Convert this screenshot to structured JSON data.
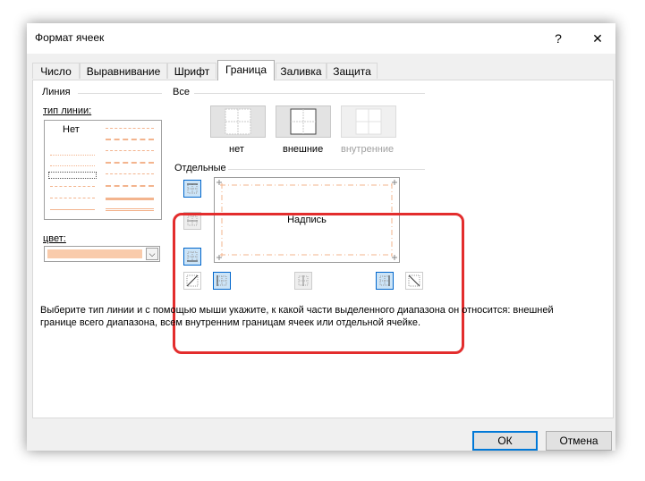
{
  "window": {
    "title": "Формат ячеек",
    "help_glyph": "?",
    "close_glyph": "✕"
  },
  "tabs": [
    {
      "label": "Число"
    },
    {
      "label": "Выравнивание"
    },
    {
      "label": "Шрифт"
    },
    {
      "label": "Граница",
      "active": true
    },
    {
      "label": "Заливка"
    },
    {
      "label": "Защита"
    }
  ],
  "line_group": {
    "title": "Линия",
    "type_label": "тип линии:",
    "none_label": "Нет",
    "color_label": "цвет:",
    "color_value": "#f9cbab"
  },
  "presets_group": {
    "title": "Все",
    "buttons": [
      {
        "label": "нет",
        "enabled": true
      },
      {
        "label": "внешние",
        "enabled": true
      },
      {
        "label": "внутренние",
        "enabled": false
      }
    ]
  },
  "border_group": {
    "title": "Отдельные",
    "preview_text": "Надпись"
  },
  "hint": {
    "line1": "Выберите тип линии и с помощью мыши укажите, к какой части выделенного диапазона он относится: внешней",
    "line2": "границе всего диапазона, всем внутренним границам ячеек или отдельной ячейке."
  },
  "buttons": {
    "ok": "ОК",
    "cancel": "Отмена"
  },
  "colors": {
    "accent": "#0078d7",
    "highlight": "#e32d2d",
    "line_color": "#f9cbab"
  }
}
